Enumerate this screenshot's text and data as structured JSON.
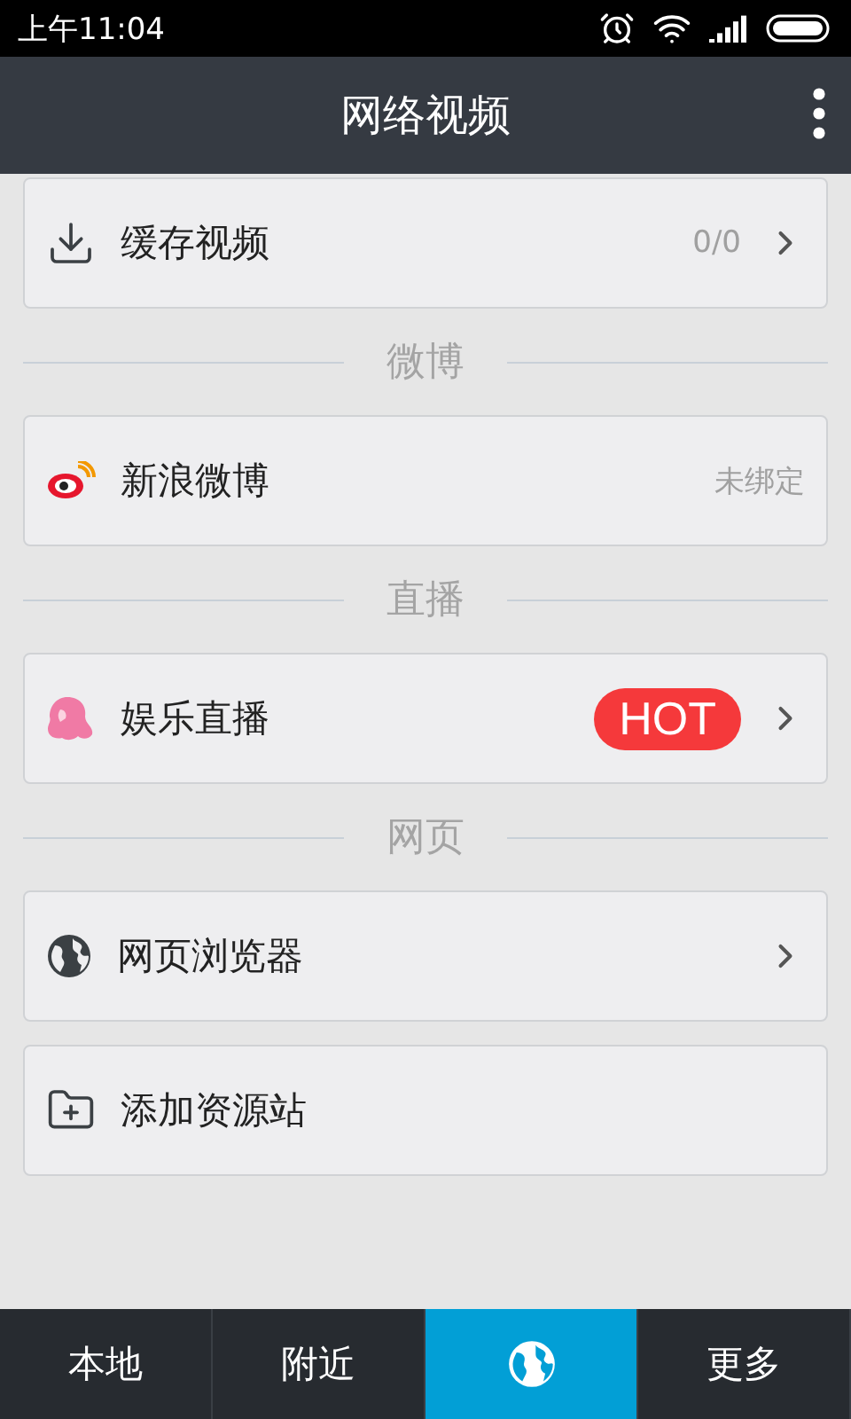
{
  "status_bar": {
    "time": "上午11:04"
  },
  "header": {
    "title": "网络视频"
  },
  "items": [
    {
      "kind": "card",
      "label": "缓存视频",
      "detail": "0/0",
      "chevron": true
    },
    {
      "kind": "section",
      "label": "微博"
    },
    {
      "kind": "card",
      "label": "新浪微博",
      "detail": "未绑定",
      "chevron": false
    },
    {
      "kind": "section",
      "label": "直播"
    },
    {
      "kind": "card",
      "label": "娱乐直播",
      "badge": "HOT",
      "chevron": true
    },
    {
      "kind": "section",
      "label": "网页"
    },
    {
      "kind": "card",
      "label": "网页浏览器",
      "chevron": true
    },
    {
      "kind": "card",
      "label": "添加资源站",
      "chevron": false
    }
  ],
  "nav": [
    {
      "label": "本地",
      "selected": false
    },
    {
      "label": "附近",
      "selected": false
    },
    {
      "selected": true
    },
    {
      "label": "更多",
      "selected": false
    }
  ]
}
